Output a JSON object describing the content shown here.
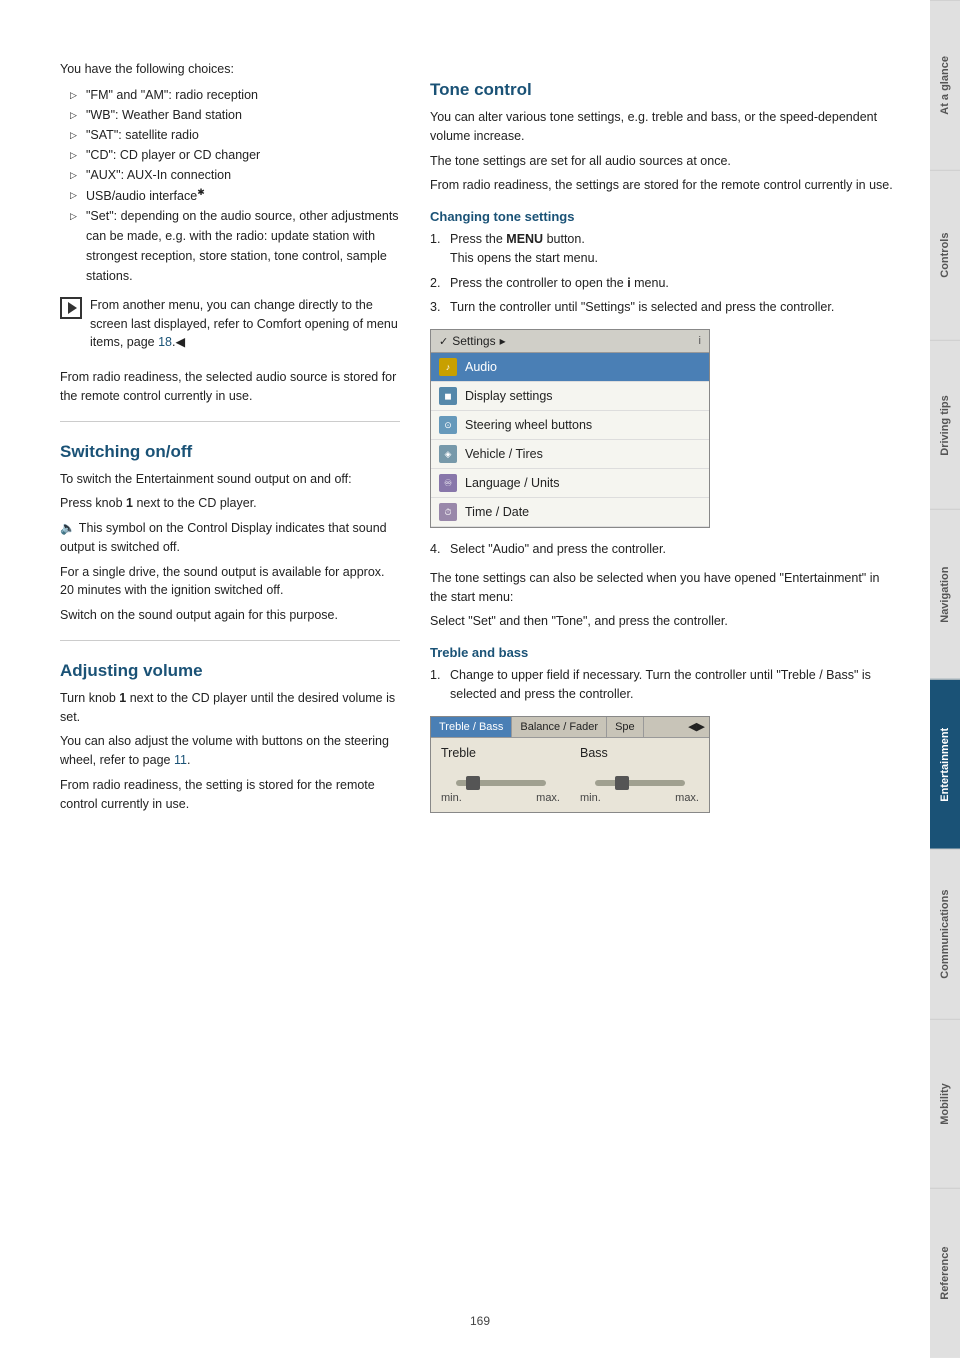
{
  "page": {
    "number": "169"
  },
  "sidebar": {
    "tabs": [
      {
        "id": "at-a-glance",
        "label": "At a glance",
        "active": false
      },
      {
        "id": "controls",
        "label": "Controls",
        "active": false
      },
      {
        "id": "driving-tips",
        "label": "Driving tips",
        "active": false
      },
      {
        "id": "navigation",
        "label": "Navigation",
        "active": false
      },
      {
        "id": "entertainment",
        "label": "Entertainment",
        "active": true
      },
      {
        "id": "communications",
        "label": "Communications",
        "active": false
      },
      {
        "id": "mobility",
        "label": "Mobility",
        "active": false
      },
      {
        "id": "reference",
        "label": "Reference",
        "active": false
      }
    ]
  },
  "left_column": {
    "intro_text": "You have the following choices:",
    "bullet_items": [
      "\"FM\" and \"AM\": radio reception",
      "\"WB\": Weather Band station",
      "\"SAT\": satellite radio",
      "\"CD\": CD player or CD changer",
      "\"AUX\": AUX-In connection",
      "USB/audio interface",
      "\"Set\": depending on the audio source, other adjustments can be made, e.g. with the radio: update station with strongest reception, store station, tone control, sample stations."
    ],
    "note_text": "From another menu, you can change directly to the screen last displayed, refer to Comfort opening of menu items, page 18.",
    "from_radio_text": "From radio readiness, the selected audio source is stored for the remote control currently in use.",
    "switching_title": "Switching on/off",
    "switching_para1": "To switch the Entertainment sound output on and off:",
    "switching_para2": "Press knob 1 next to the CD player.",
    "switching_para3": "This symbol on the Control Display indicates that sound output is switched off.",
    "switching_para4": "For a single drive, the sound output is available for approx. 20 minutes with the ignition switched off.",
    "switching_para5": "Switch on the sound output again for this purpose.",
    "adjusting_title": "Adjusting volume",
    "adjusting_para1": "Turn knob 1 next to the CD player until the desired volume is set.",
    "adjusting_para2": "You can also adjust the volume with buttons on the steering wheel, refer to page 11.",
    "adjusting_para3": "From radio readiness, the setting is stored for the remote control currently in use."
  },
  "right_column": {
    "tone_control_title": "Tone control",
    "tone_para1": "You can alter various tone settings, e.g. treble and bass, or the speed-dependent volume increase.",
    "tone_para2": "The tone settings are set for all audio sources at once.",
    "tone_para3": "From radio readiness, the settings are stored for the remote control currently in use.",
    "changing_tone_title": "Changing tone settings",
    "steps": [
      {
        "num": "1.",
        "text_before": "Press the ",
        "bold": "MENU",
        "text_after": " button.\nThis opens the start menu."
      },
      {
        "num": "2.",
        "text_before": "Press the controller to open the ",
        "bold": "i",
        "text_after": " menu."
      },
      {
        "num": "3.",
        "text_before": "Turn the controller until \"Settings\" is selected and press the controller.",
        "bold": "",
        "text_after": ""
      }
    ],
    "menu_screenshot": {
      "header": "Settings",
      "header_right": "i",
      "items": [
        {
          "label": "Audio",
          "icon": "audio",
          "selected": true
        },
        {
          "label": "Display settings",
          "icon": "display",
          "selected": false
        },
        {
          "label": "Steering wheel buttons",
          "icon": "steering",
          "selected": false
        },
        {
          "label": "Vehicle / Tires",
          "icon": "vehicle",
          "selected": false
        },
        {
          "label": "Language / Units",
          "icon": "language",
          "selected": false
        },
        {
          "label": "Time / Date",
          "icon": "time",
          "selected": false
        }
      ]
    },
    "step4": "Select \"Audio\" and press the controller.",
    "tone_alt_text": "The tone settings can also be selected when you have opened \"Entertainment\" in the start menu:",
    "tone_alt_text2": "Select \"Set\" and then \"Tone\", and press the controller.",
    "treble_bass_title": "Treble and bass",
    "treble_bass_step1": "Change to upper field if necessary. Turn the controller until \"Treble / Bass\" is selected and press the controller.",
    "treble_bass_screenshot": {
      "tabs": [
        "Treble / Bass",
        "Balance / Fader",
        "Spe",
        ""
      ],
      "treble_label": "Treble",
      "bass_label": "Bass",
      "min_label": "min.",
      "max_label": "max."
    }
  }
}
